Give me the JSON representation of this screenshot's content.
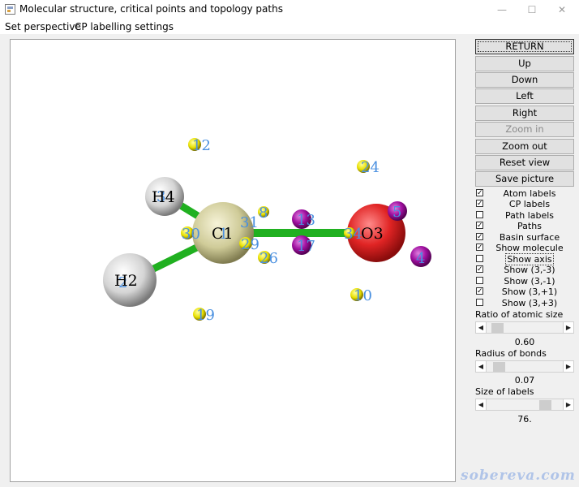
{
  "window": {
    "title": "Molecular structure, critical points and topology paths",
    "minimize_glyph": "—",
    "maximize_glyph": "☐",
    "close_glyph": "✕"
  },
  "menu": [
    "Set perspective",
    "CP labelling settings"
  ],
  "buttons": [
    {
      "label": "RETURN",
      "enabled": true
    },
    {
      "label": "Up",
      "enabled": true
    },
    {
      "label": "Down",
      "enabled": true
    },
    {
      "label": "Left",
      "enabled": true
    },
    {
      "label": "Right",
      "enabled": true
    },
    {
      "label": "Zoom in",
      "enabled": false
    },
    {
      "label": "Zoom out",
      "enabled": true
    },
    {
      "label": "Reset view",
      "enabled": true
    },
    {
      "label": "Save picture",
      "enabled": true
    }
  ],
  "checkboxes": [
    {
      "label": "Atom labels",
      "checked": true
    },
    {
      "label": "CP labels",
      "checked": true
    },
    {
      "label": "Path labels",
      "checked": false
    },
    {
      "label": "Paths",
      "checked": true
    },
    {
      "label": "Basin surface",
      "checked": true
    },
    {
      "label": "Show molecule",
      "checked": true
    },
    {
      "label": "Show axis",
      "checked": false
    },
    {
      "label": "Show (3,-3)",
      "checked": true
    },
    {
      "label": "Show (3,-1)",
      "checked": false
    },
    {
      "label": "Show (3,+1)",
      "checked": true
    },
    {
      "label": "Show (3,+3)",
      "checked": false
    }
  ],
  "sliders": [
    {
      "label": "Ratio of atomic size",
      "value": "0.60",
      "fraction": 0.08
    },
    {
      "label": "Radius of bonds",
      "value": "0.07",
      "fraction": 0.1
    },
    {
      "label": "Size of labels",
      "value": "76.",
      "fraction": 0.82
    }
  ],
  "molecule": {
    "atoms": [
      {
        "label": "H4",
        "color": "#e8e8e8"
      },
      {
        "label": "C1",
        "color": "#d8d4a0"
      },
      {
        "label": "H2",
        "color": "#e8e8e8"
      },
      {
        "label": "O3",
        "color": "#e83030"
      }
    ],
    "cp_labels": [
      "12",
      "24",
      "3",
      "8",
      "31",
      "30",
      "1",
      "29",
      "26",
      "13",
      "17",
      "5",
      "34",
      "2",
      "4",
      "10",
      "19"
    ],
    "bond_color": "#20b020",
    "label_color": "#4a90e0"
  },
  "watermark": "sobereva.com"
}
